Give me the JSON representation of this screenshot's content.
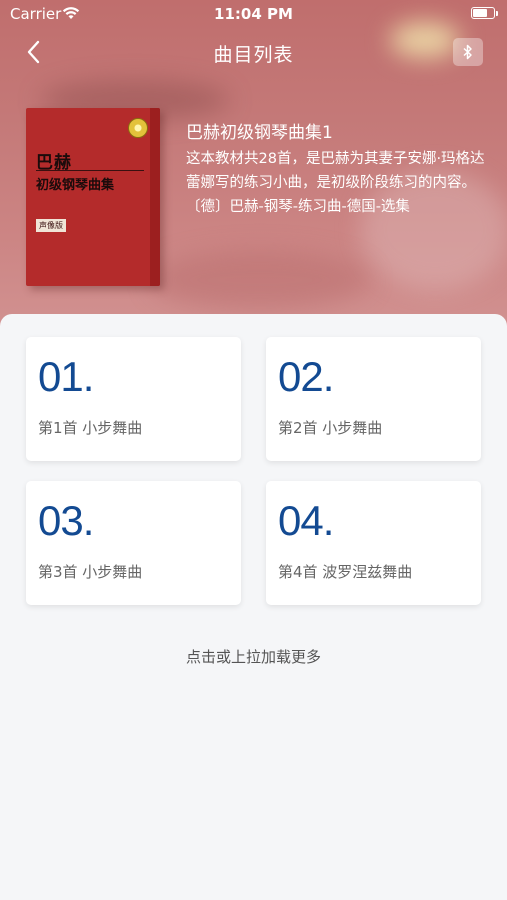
{
  "status": {
    "carrier": "Carrier",
    "time": "11:04 PM",
    "battery_level": 0.75
  },
  "nav": {
    "title": "曲目列表",
    "back_icon": "chevron-left-icon",
    "bluetooth_icon": "bluetooth-icon"
  },
  "book": {
    "cover_title": "巴赫",
    "cover_subtitle": "初级钢琴曲集",
    "cover_tag": "声像版",
    "title": "巴赫初级钢琴曲集1",
    "description": "这本教材共28首，是巴赫为其妻子安娜·玛格达蕾娜写的练习小曲，是初级阶段练习的内容。〔德〕巴赫-钢琴-练习曲-德国-选集"
  },
  "songs": [
    {
      "num": "01.",
      "name": "第1首 小步舞曲"
    },
    {
      "num": "02.",
      "name": "第2首 小步舞曲"
    },
    {
      "num": "03.",
      "name": "第3首 小步舞曲"
    },
    {
      "num": "04.",
      "name": "第4首 波罗涅兹舞曲"
    }
  ],
  "load_more": "点击或上拉加载更多",
  "colors": {
    "accent_number": "#134a92",
    "hero_bg": "#c47978",
    "cover": "#b42b2b"
  }
}
